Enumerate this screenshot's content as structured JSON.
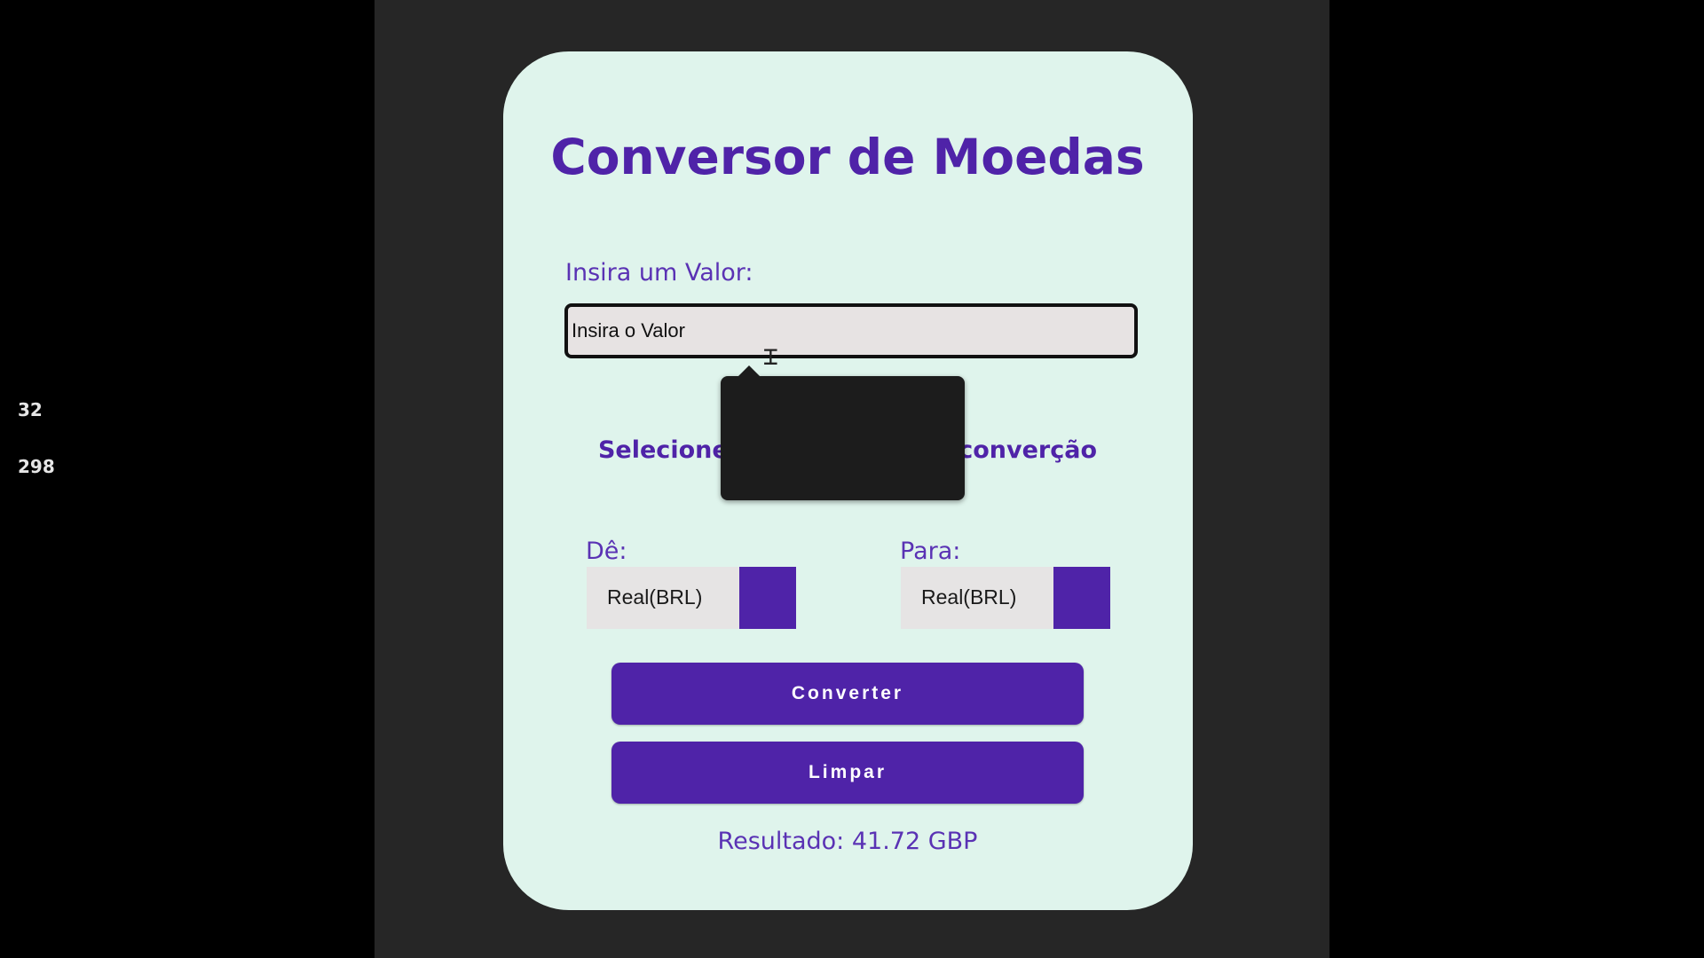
{
  "converter": {
    "title": "Conversor de Moedas",
    "value_label": "Insira um Valor:",
    "value_placeholder": "Insira o Valor",
    "select_heading": "Selecione as moedas para converção",
    "autocomplete": [
      "32",
      "298"
    ],
    "from_label": "Dê:",
    "from_value": "Real(BRL)",
    "to_label": "Para:",
    "to_value": "Real(BRL)",
    "convert_label": "Converter",
    "clear_label": "Limpar",
    "result_text": "Resultado: 41.72 GBP"
  },
  "colors": {
    "accent": "#4f23a8",
    "card_bg": "#dff4ec",
    "page_bg": "#262626"
  }
}
